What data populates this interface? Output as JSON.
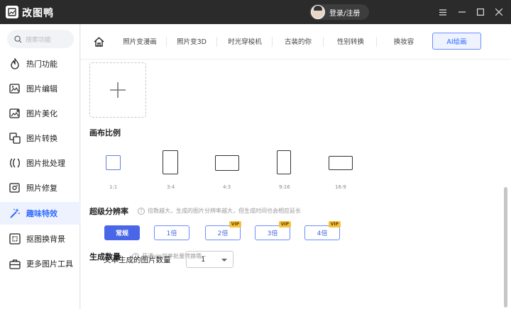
{
  "app": {
    "name": "改图鸭",
    "login_label": "登录/注册"
  },
  "window_controls": [
    "menu-icon",
    "minimize-icon",
    "maximize-icon",
    "close-icon"
  ],
  "sidebar": {
    "search_placeholder": "搜索功能",
    "items": [
      {
        "label": "热门功能",
        "icon": "flame-icon"
      },
      {
        "label": "图片编辑",
        "icon": "image-edit-icon"
      },
      {
        "label": "图片美化",
        "icon": "image-beautify-icon"
      },
      {
        "label": "图片转换",
        "icon": "image-convert-icon"
      },
      {
        "label": "图片批处理",
        "icon": "batch-icon"
      },
      {
        "label": "照片修复",
        "icon": "photo-repair-icon"
      },
      {
        "label": "趣味特效",
        "icon": "magic-wand-icon",
        "active": true
      },
      {
        "label": "抠图换背景",
        "icon": "cutout-icon"
      },
      {
        "label": "更多图片工具",
        "icon": "toolbox-icon"
      }
    ]
  },
  "tabs": [
    {
      "label": "照片变漫画"
    },
    {
      "label": "照片变3D"
    },
    {
      "label": "时光穿梭机"
    },
    {
      "label": "古装的你"
    },
    {
      "label": "性别转换"
    },
    {
      "label": "换妆容"
    },
    {
      "label": "AI绘画",
      "active": true
    }
  ],
  "canvas": {
    "title": "画布比例",
    "ratios": [
      "1:1",
      "3:4",
      "4:3",
      "9:16",
      "16:9"
    ],
    "selected": "1:1"
  },
  "resolution": {
    "title": "超级分辨率",
    "hint": "倍数越大，生成的图片分辨率越大，但生成时间也会相应延长",
    "options": [
      {
        "label": "常规",
        "vip": false,
        "active": true
      },
      {
        "label": "1倍",
        "vip": false
      },
      {
        "label": "2倍",
        "vip": true
      },
      {
        "label": "3倍",
        "vip": true
      },
      {
        "label": "4倍",
        "vip": true
      }
    ],
    "vip_badge": "VIP"
  },
  "count": {
    "title": "生成数量",
    "hint": "开通vip可享批量转换哦~",
    "field_label": "文本生成的图片数量",
    "value": "1"
  },
  "colors": {
    "accent": "#4a66e8",
    "titlebar": "#2b2b2b",
    "vip": "#f5c23a"
  }
}
